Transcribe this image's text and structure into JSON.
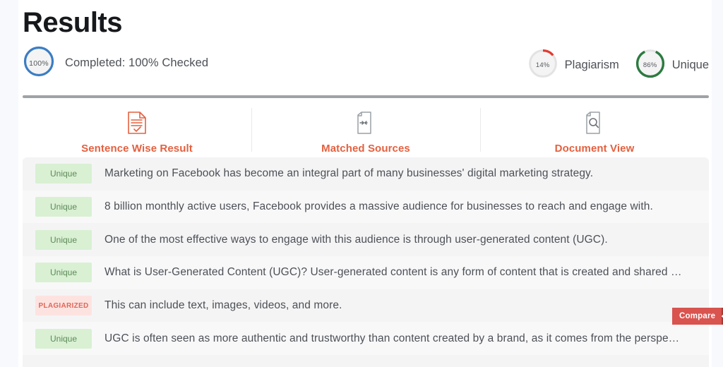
{
  "header": {
    "title": "Results",
    "completed": {
      "donut_value": "100%",
      "donut_percent": 100,
      "donut_color": "#3b7dc4",
      "text": "Completed: 100% Checked"
    },
    "scores": [
      {
        "value": "14%",
        "percent": 14,
        "label": "Plagiarism",
        "color": "#e03c31",
        "track": "#e3e3e3",
        "icon": "donut-chart-icon"
      },
      {
        "value": "86%",
        "percent": 86,
        "label": "Unique",
        "color": "#2c7a41",
        "track": "#e3e3e3",
        "icon": "donut-chart-icon"
      }
    ]
  },
  "tabs": [
    {
      "label": "Sentence Wise Result",
      "icon": "document-check-icon",
      "active": true
    },
    {
      "label": "Matched Sources",
      "icon": "document-compare-icon",
      "active": false
    },
    {
      "label": "Document View",
      "icon": "document-search-icon",
      "active": false
    }
  ],
  "results": {
    "rows": [
      {
        "status": "Unique",
        "status_type": "unique",
        "text": "Marketing on Facebook has become an integral part of many businesses' digital marketing strategy."
      },
      {
        "status": "Unique",
        "status_type": "unique",
        "text": "8 billion monthly active users, Facebook provides a massive audience for businesses to reach and engage with."
      },
      {
        "status": "Unique",
        "status_type": "unique",
        "text": "One of the most effective ways to engage with this audience is through user-generated content (UGC)."
      },
      {
        "status": "Unique",
        "status_type": "unique",
        "text": "What is User-Generated Content (UGC)? User-generated content is any form of content that is created and shared …"
      },
      {
        "status": "PLAGIARIZED",
        "status_type": "plagiarized",
        "text": "This can include text, images, videos, and more."
      },
      {
        "status": "Unique",
        "status_type": "unique",
        "text": "UGC is often seen as more authentic and trustworthy than content created by a brand, as it comes from the perspe…"
      }
    ]
  },
  "compare_button": {
    "label": "Compare"
  },
  "colors": {
    "accent": "#e4603f",
    "unique_bg": "#d9f0d3",
    "unique_text": "#5d8a58",
    "plagiarized_bg": "#fde3e0",
    "plagiarized_text": "#e0675a",
    "compare_bg": "#d9534f"
  }
}
